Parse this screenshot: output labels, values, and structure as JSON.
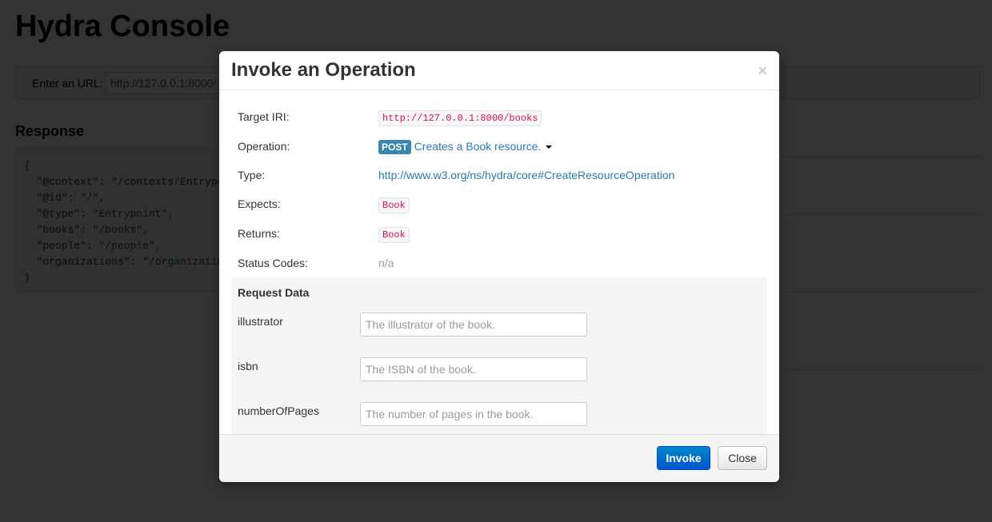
{
  "page": {
    "title": "Hydra Console",
    "url_label": "Enter an URL:",
    "url_value": "http://127.0.0.1:8000/",
    "response_heading": "Response",
    "response_lines": [
      [
        "{",
        ""
      ],
      [
        "  \"@context\": ",
        "\"/contexts/Entrypoint.jsonld\","
      ],
      [
        "  \"@id\": ",
        "\"/\","
      ],
      [
        "  \"@type\": ",
        "\"Entrypoint\","
      ],
      [
        "  \"books\": ",
        "\"/books\","
      ],
      [
        "  \"people\": ",
        "\"/people\","
      ],
      [
        "  \"organizations\": ",
        "\"/organizations\""
      ],
      [
        "}",
        ""
      ]
    ]
  },
  "modal": {
    "title": "Invoke an Operation",
    "close_symbol": "×",
    "target_iri_label": "Target IRI:",
    "target_iri": "http://127.0.0.1:8000/books",
    "operation_label": "Operation:",
    "method": "POST",
    "operation": "Creates a Book resource.",
    "type_label": "Type:",
    "type": "http://www.w3.org/ns/hydra/core#CreateResourceOperation",
    "expects_label": "Expects:",
    "expects": "Book",
    "returns_label": "Returns:",
    "returns": "Book",
    "status_label": "Status Codes:",
    "status": "n/a",
    "request_data_label": "Request Data",
    "fields": [
      {
        "name": "illustrator",
        "placeholder": "The illustrator of the book."
      },
      {
        "name": "isbn",
        "placeholder": "The ISBN of the book."
      },
      {
        "name": "numberOfPages",
        "placeholder": "The number of pages in the book."
      }
    ],
    "invoke_label": "Invoke",
    "close_label": "Close"
  },
  "colors": {
    "accent": "#0074cc",
    "method_badge": "#3a87ad",
    "code": "#d14"
  }
}
